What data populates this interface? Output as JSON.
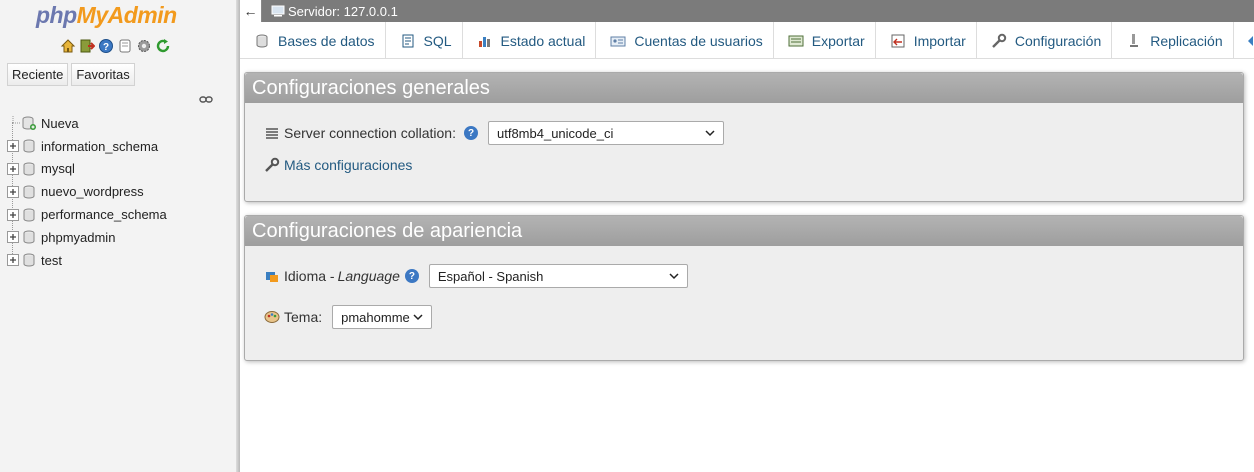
{
  "app": {
    "logo_part1": "php",
    "logo_part2": "MyAdmin"
  },
  "nav": {
    "icons": [
      "home-icon",
      "logout-icon",
      "help-icon",
      "docs-icon",
      "settings-gear-icon",
      "reload-icon"
    ],
    "tabs": {
      "recent": "Reciente",
      "favorites": "Favoritas"
    },
    "new_item": "Nueva",
    "databases": [
      "information_schema",
      "mysql",
      "nuevo_wordpress",
      "performance_schema",
      "phpmyadmin",
      "test"
    ]
  },
  "topbar": {
    "server_label": "Servidor: 127.0.0.1"
  },
  "menu": {
    "tabs": [
      {
        "label": "Bases de datos",
        "icon": "database-icon"
      },
      {
        "label": "SQL",
        "icon": "sql-icon"
      },
      {
        "label": "Estado actual",
        "icon": "status-icon"
      },
      {
        "label": "Cuentas de usuarios",
        "icon": "users-icon"
      },
      {
        "label": "Exportar",
        "icon": "export-icon"
      },
      {
        "label": "Importar",
        "icon": "import-icon"
      },
      {
        "label": "Configuración",
        "icon": "wrench-icon"
      },
      {
        "label": "Replicación",
        "icon": "replication-icon"
      }
    ]
  },
  "general": {
    "title": "Configuraciones generales",
    "collation_label": "Server connection collation:",
    "collation_value": "utf8mb4_unicode_ci",
    "more_settings": "Más configuraciones"
  },
  "appearance": {
    "title": "Configuraciones de apariencia",
    "language_label": "Idioma - ",
    "language_label_en": "Language",
    "language_value": "Español - Spanish",
    "theme_label": "Tema:",
    "theme_value": "pmahomme"
  },
  "colors": {
    "link": "#235a81",
    "panel_header": "#a8a8a8",
    "topbar": "#7b7b7b",
    "logo_php": "#6c78af",
    "logo_myadmin": "#f29a1d"
  }
}
